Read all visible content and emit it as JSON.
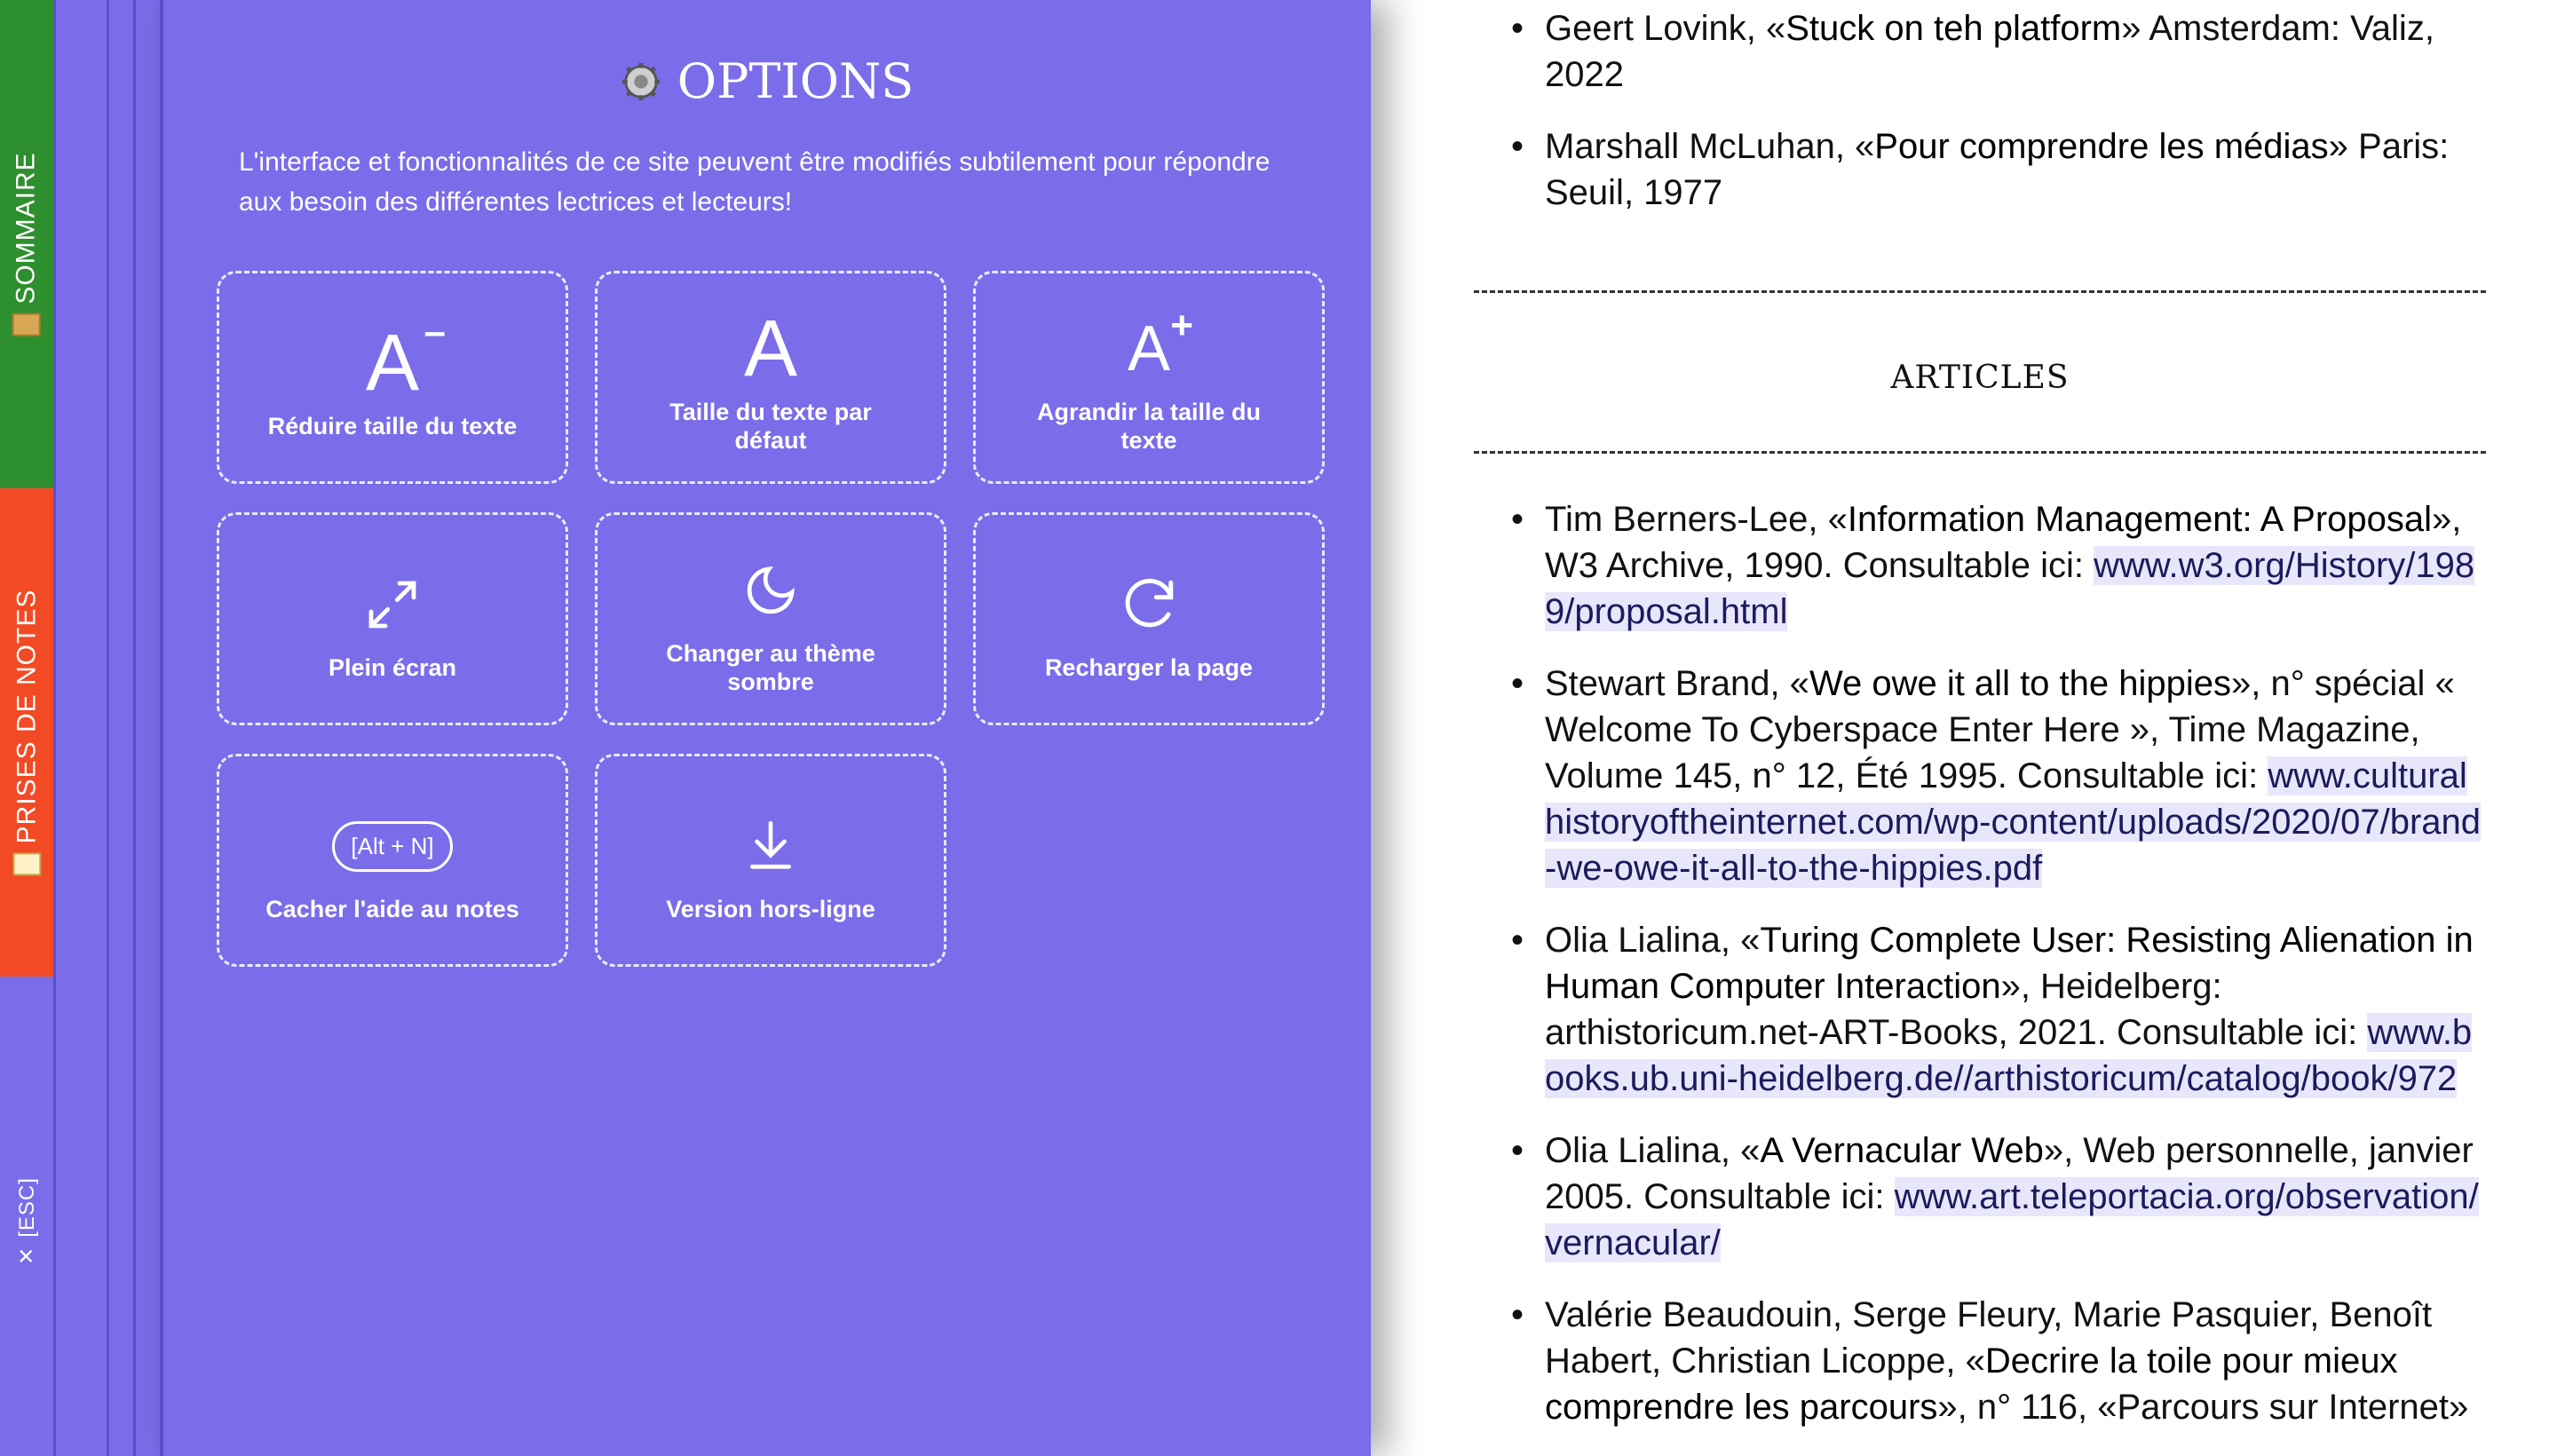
{
  "sidebar": {
    "sommaire": "SOMMAIRE",
    "notes": "PRISES DE NOTES",
    "esc": "[ESC]",
    "close": "✕"
  },
  "options": {
    "title": "OPTIONS",
    "description": "L'interface et fonctionnalités de ce site peuvent être modifiés subtilement pour répondre aux besoin des différentes lectrices et lecteurs!",
    "tiles": [
      {
        "label": "Réduire taille du texte",
        "glyph": "A",
        "sup": "–"
      },
      {
        "label": "Taille du texte par défaut",
        "glyph": "A"
      },
      {
        "label": "Agrandir la taille du texte",
        "glyph": "A",
        "sup": "+"
      },
      {
        "label": "Plein écran"
      },
      {
        "label": "Changer au thème sombre"
      },
      {
        "label": "Recharger la page"
      },
      {
        "label": "Cacher l'aide au notes",
        "kbd": "[Alt + N]"
      },
      {
        "label": "Version hors-ligne"
      }
    ]
  },
  "content": {
    "books_tail": [
      {
        "pre": "Geert Lovink, «",
        "work": "Stuck on teh platform",
        "post": "» Amsterdam: Valiz, 2022"
      },
      {
        "pre": "Marshall McLuhan, «",
        "work": "Pour comprendre les médias",
        "post": "» Paris: Seuil, 1977"
      }
    ],
    "section_title": "ARTICLES",
    "articles": [
      {
        "pre": "Tim Berners-Lee, «",
        "work": "Information Management: A Proposal",
        "post": "», W3 Archive, 1990. Consultable ici: ",
        "link": "www.w3.org/History/1989/proposal.html"
      },
      {
        "pre": "Stewart Brand, «",
        "work": "We owe it all to the hippies",
        "post": "», n° spécial « Welcome To Cyberspace Enter Here », Time Magazine, Volume 145, n° 12, Été 1995. Consultable ici: ",
        "link": "www.culturalhistoryoftheinternet.com/wp-content/uploads/2020/07/brand-we-owe-it-all-to-the-hippies.pdf"
      },
      {
        "pre": "Olia Lialina, «",
        "work": "Turing Complete User: Resisting Alienation in Human Computer Interaction",
        "post": "», Heidelberg: arthistoricum.net-ART-Books, 2021. Consultable ici: ",
        "link": "www.books.ub.uni-heidelberg.de//arthistoricum/catalog/book/972"
      },
      {
        "pre": "Olia Lialina, «",
        "work": "A Vernacular Web",
        "post": "», Web personnelle, janvier 2005. Consultable ici: ",
        "link": "www.art.teleportacia.org/observation/vernacular/"
      },
      {
        "pre": "Valérie Beaudouin, Serge Fleury, Marie Pasquier, Benoît Habert, Christian Licoppe, «",
        "work": "Decrire la toile pour mieux comprendre les parcours",
        "post": "», n° 116, «Parcours sur Internet»",
        "link": ""
      }
    ]
  }
}
